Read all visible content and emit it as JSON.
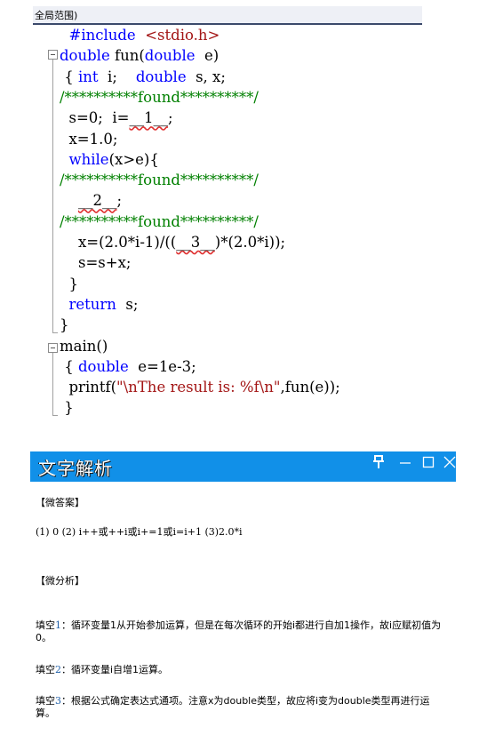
{
  "editor": {
    "scope_label": "全局范围)",
    "lines": [
      {
        "indent": "  ",
        "tokens": [
          {
            "t": "#include",
            "c": "pp"
          },
          {
            "t": "  ",
            "c": "tx"
          },
          {
            "t": "<stdio.h>",
            "c": "inc"
          }
        ]
      },
      {
        "indent": "",
        "tokens": [
          {
            "t": "double",
            "c": "kw"
          },
          {
            "t": " fun(",
            "c": "tx"
          },
          {
            "t": "double",
            "c": "kw"
          },
          {
            "t": "  e)",
            "c": "tx"
          }
        ]
      },
      {
        "indent": " ",
        "tokens": [
          {
            "t": "{ ",
            "c": "tx"
          },
          {
            "t": "int",
            "c": "kw"
          },
          {
            "t": "  i;    ",
            "c": "tx"
          },
          {
            "t": "double",
            "c": "kw"
          },
          {
            "t": "  s, x;",
            "c": "tx"
          }
        ]
      },
      {
        "indent": "",
        "tokens": [
          {
            "t": "/**********found**********/",
            "c": "cm"
          }
        ]
      },
      {
        "indent": "  ",
        "tokens": [
          {
            "t": "s=0;  i=",
            "c": "tx"
          },
          {
            "t": "__1__",
            "c": "blank"
          },
          {
            "t": ";",
            "c": "tx"
          }
        ]
      },
      {
        "indent": "  ",
        "tokens": [
          {
            "t": "x=1.0;",
            "c": "tx"
          }
        ]
      },
      {
        "indent": "  ",
        "tokens": [
          {
            "t": "while",
            "c": "kw"
          },
          {
            "t": "(x>e){",
            "c": "tx"
          }
        ]
      },
      {
        "indent": "",
        "tokens": [
          {
            "t": "/**********found**********/",
            "c": "cm"
          }
        ]
      },
      {
        "indent": "    ",
        "tokens": [
          {
            "t": "__2__",
            "c": "blank"
          },
          {
            "t": ";",
            "c": "tx"
          }
        ]
      },
      {
        "indent": "",
        "tokens": [
          {
            "t": "/**********found**********/",
            "c": "cm"
          }
        ]
      },
      {
        "indent": "    ",
        "tokens": [
          {
            "t": "x=(2.0*i-1)/((",
            "c": "tx"
          },
          {
            "t": "__3__",
            "c": "blank"
          },
          {
            "t": ")*(2.0*i));",
            "c": "tx"
          }
        ]
      },
      {
        "indent": "    ",
        "tokens": [
          {
            "t": "s=s+x;",
            "c": "tx"
          }
        ]
      },
      {
        "indent": "  ",
        "tokens": [
          {
            "t": "}",
            "c": "tx"
          }
        ]
      },
      {
        "indent": "  ",
        "tokens": [
          {
            "t": "return",
            "c": "kw"
          },
          {
            "t": "  s;",
            "c": "tx"
          }
        ]
      },
      {
        "indent": "",
        "tokens": [
          {
            "t": "}",
            "c": "tx"
          }
        ]
      },
      {
        "indent": "",
        "tokens": [
          {
            "t": "main()",
            "c": "tx"
          }
        ]
      },
      {
        "indent": " ",
        "tokens": [
          {
            "t": "{ ",
            "c": "tx"
          },
          {
            "t": "double",
            "c": "kw"
          },
          {
            "t": "  e=1e-3;",
            "c": "tx"
          }
        ]
      },
      {
        "indent": "  ",
        "tokens": [
          {
            "t": "printf(",
            "c": "tx"
          },
          {
            "t": "\"\\nThe result is: %f\\n\"",
            "c": "str"
          },
          {
            "t": ",fun(e));",
            "c": "tx"
          }
        ]
      },
      {
        "indent": " ",
        "tokens": [
          {
            "t": "}",
            "c": "tx"
          }
        ]
      }
    ]
  },
  "panel": {
    "title": "文字解析",
    "header_color": "#1190e8",
    "buttons": [
      {
        "name": "pin-icon",
        "glyph": "卆"
      },
      {
        "name": "minimize-icon",
        "glyph": "—"
      },
      {
        "name": "maximize-icon",
        "glyph": "☐"
      },
      {
        "name": "close-icon",
        "glyph": "✕"
      }
    ],
    "answer_title": "【微答案】",
    "answer_text": "(1) 0 (2) i++或++i或i+=1或i=i+1 (3)2.0*i",
    "analysis_title": "【微分析】",
    "paragraphs": [
      {
        "label": "填空",
        "num": "1",
        "text": "：循环变量1从开始参加运算，但是在每次循环的开始i都进行自加1操作，故i应赋初值为0。"
      },
      {
        "label": "填空",
        "num": "2",
        "text": "：循环变量i自增1运算。"
      },
      {
        "label": "填空",
        "num": "3",
        "text": "：根据公式确定表达式通项。注意x为double类型，故应将i变为double类型再进行运算。"
      }
    ]
  }
}
